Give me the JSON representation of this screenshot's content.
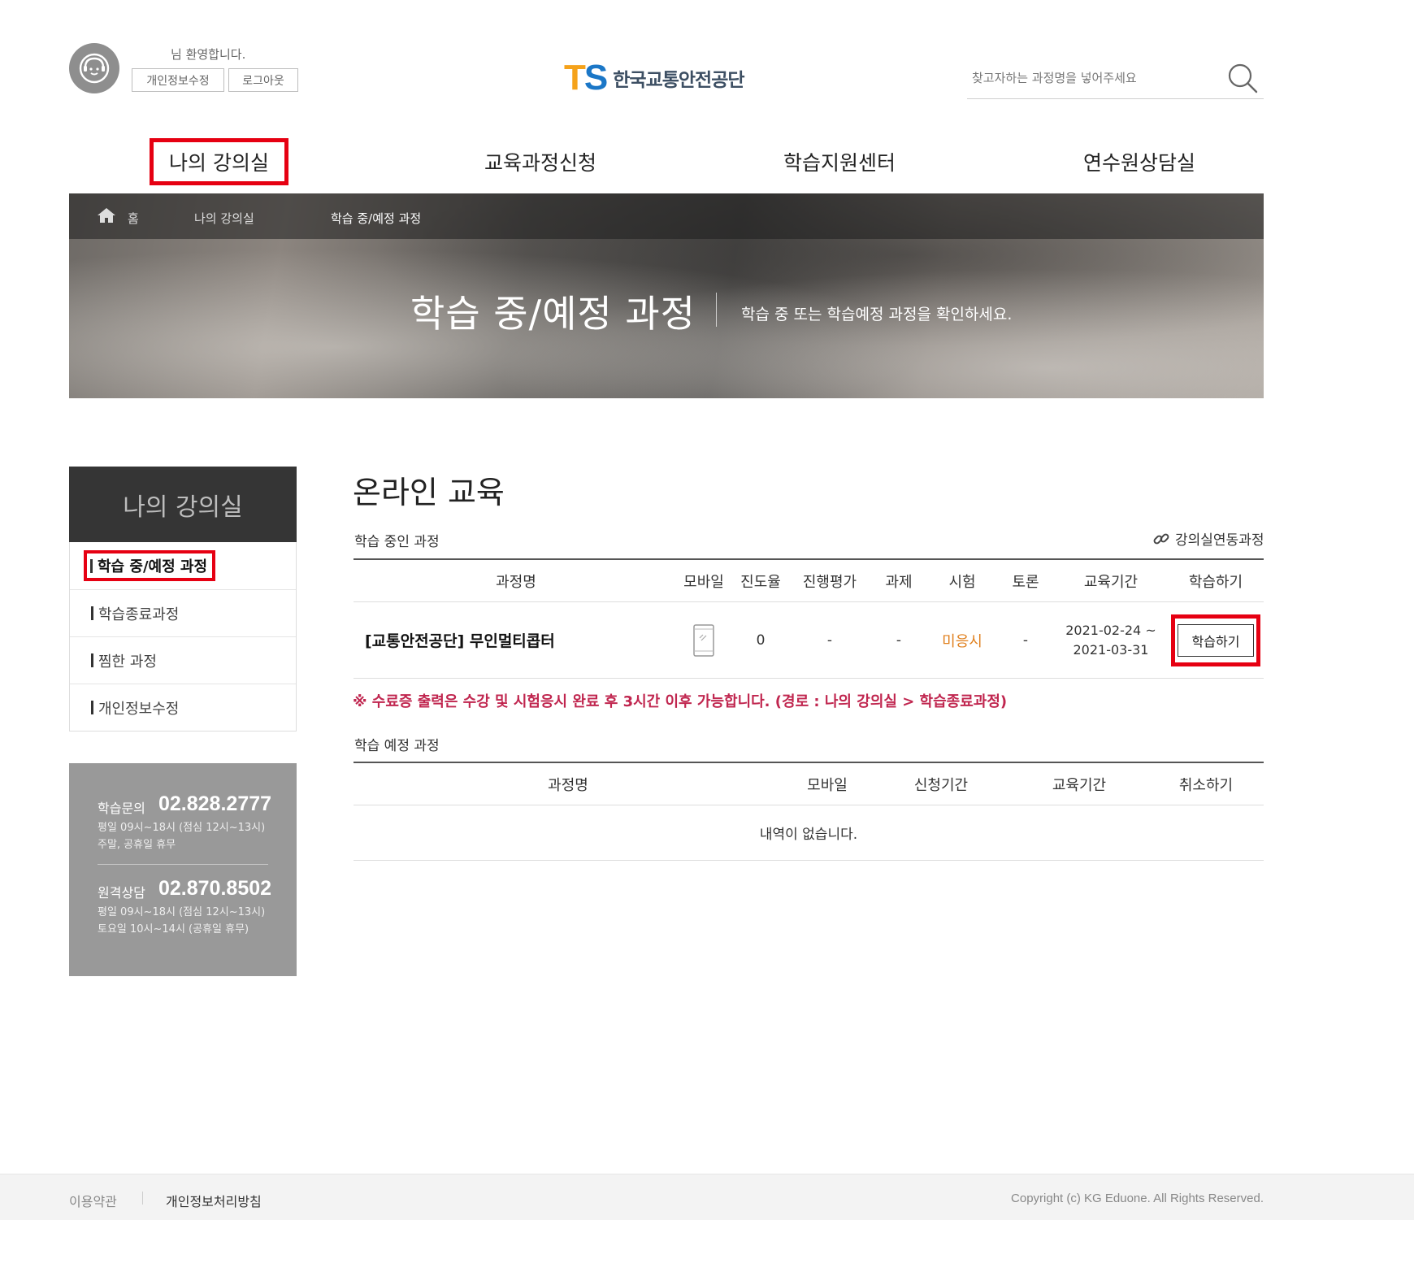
{
  "header": {
    "welcome": "님 환영합니다.",
    "profile_button": "개인정보수정",
    "logout_button": "로그아웃",
    "logo_mark": "TS",
    "logo_name": "한국교통안전공단",
    "search_placeholder": "찾고자하는 과정명을 넣어주세요"
  },
  "gnb": {
    "items": [
      {
        "label": "나의 강의실",
        "active": true
      },
      {
        "label": "교육과정신청",
        "active": false
      },
      {
        "label": "학습지원센터",
        "active": false
      },
      {
        "label": "연수원상담실",
        "active": false
      }
    ]
  },
  "breadcrumb": {
    "home": "홈",
    "level1": "나의 강의실",
    "level2": "학습 중/예정 과정"
  },
  "banner": {
    "title": "학습 중/예정 과정",
    "subtitle": "학습 중 또는 학습예정 과정을 확인하세요."
  },
  "sidebar": {
    "title": "나의 강의실",
    "items": [
      {
        "label": "학습 중/예정 과정",
        "active": true
      },
      {
        "label": "학습종료과정",
        "active": false
      },
      {
        "label": "찜한 과정",
        "active": false
      },
      {
        "label": "개인정보수정",
        "active": false
      }
    ],
    "contact": {
      "learning_label": "학습문의",
      "learning_number": "02.828.2777",
      "learning_hours_1": "평일 09시~18시 (점심 12시~13시)",
      "learning_hours_2": "주말, 공휴일 휴무",
      "remote_label": "원격상담",
      "remote_number": "02.870.8502",
      "remote_hours_1": "평일 09시~18시 (점심 12시~13시)",
      "remote_hours_2": "토요일 10시~14시 (공휴일 휴무)"
    }
  },
  "main": {
    "title": "온라인 교육",
    "in_progress": {
      "section_label": "학습 중인 과정",
      "link_label": "강의실연동과정",
      "columns": [
        "과정명",
        "모바일",
        "진도율",
        "진행평가",
        "과제",
        "시험",
        "토론",
        "교육기간",
        "학습하기"
      ],
      "rows": [
        {
          "course": "[교통안전공단] 무인멀티콥터",
          "mobile_icon": "mobile-phone-icon",
          "progress": "0",
          "evaluation": "-",
          "assignment": "-",
          "exam": "미응시",
          "discussion": "-",
          "period_start": "2021-02-24 ~",
          "period_end": "2021-03-31",
          "action": "학습하기"
        }
      ]
    },
    "notice": "※ 수료증 출력은 수강 및 시험응시 완료 후 3시간 이후 가능합니다. (경로 : 나의 강의실 > 학습종료과정)",
    "scheduled": {
      "section_label": "학습 예정 과정",
      "columns": [
        "과정명",
        "모바일",
        "신청기간",
        "교육기간",
        "취소하기"
      ],
      "empty_message": "내역이 없습니다."
    }
  },
  "footer": {
    "terms": "이용약관",
    "privacy": "개인정보처리방침",
    "copyright": "Copyright (c) KG Eduone. All Rights Reserved."
  },
  "colors": {
    "highlight": "#e60012",
    "exam_status": "#e0801e",
    "notice": "#c0264f",
    "sidebar_head": "#353535",
    "contact_bg": "#999999"
  }
}
